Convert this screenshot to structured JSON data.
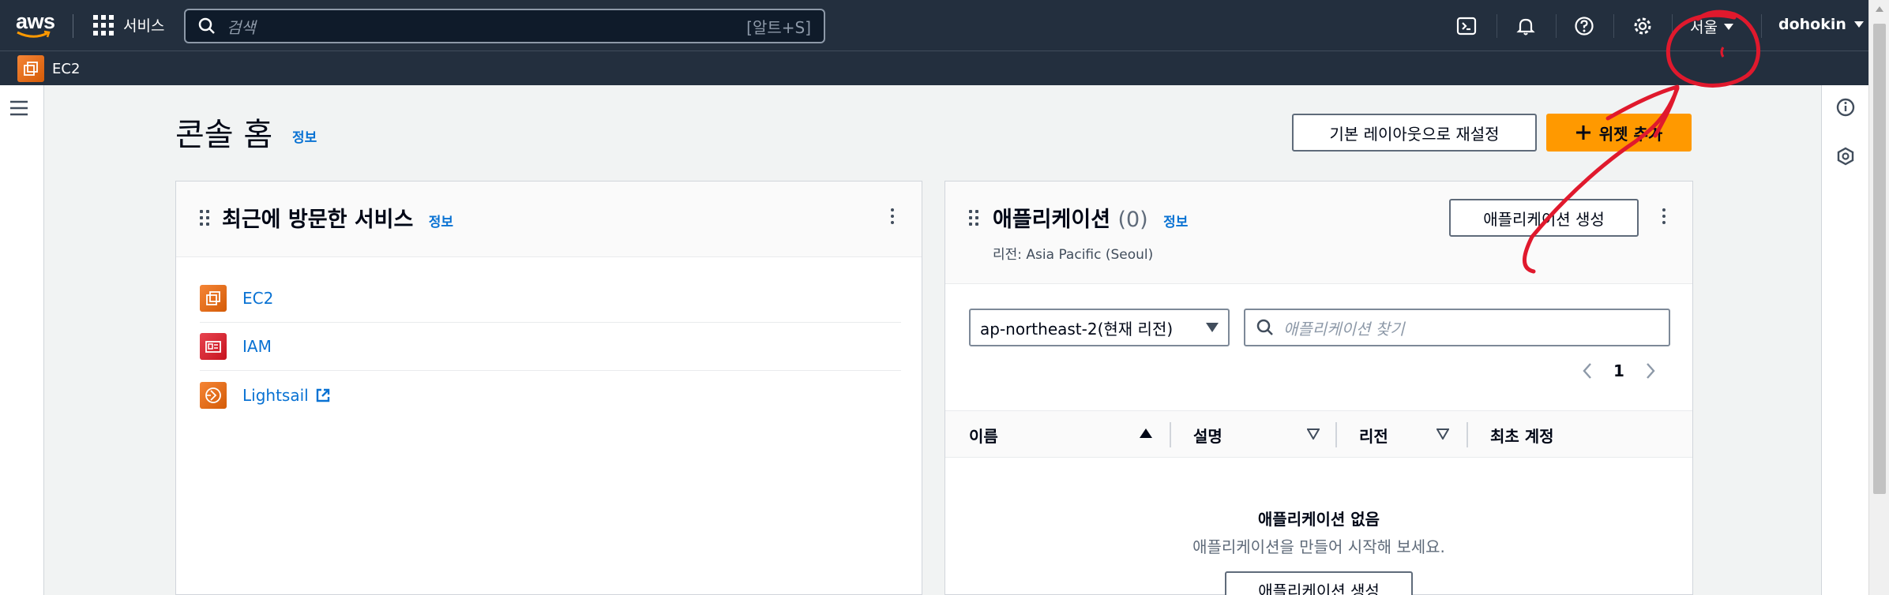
{
  "nav": {
    "logo": "aws",
    "services_label": "서비스",
    "search_placeholder": "검색",
    "search_shortcut": "[알트+S]",
    "region": "서울",
    "user": "dohokin",
    "icons": [
      "cloudshell-icon",
      "bell-icon",
      "help-icon",
      "settings-icon"
    ]
  },
  "favorites": {
    "ec2_label": "EC2"
  },
  "page": {
    "title": "콘솔 홈",
    "info": "정보",
    "reset_button": "기본 레이아웃으로 재설정",
    "add_widget_button": "위젯 추가"
  },
  "recent": {
    "title": "최근에 방문한 서비스",
    "info": "정보",
    "items": [
      {
        "label": "EC2",
        "icon": "ec2-icon",
        "color": "#e8731f"
      },
      {
        "label": "IAM",
        "icon": "iam-icon",
        "color": "#dd344c"
      },
      {
        "label": "Lightsail",
        "icon": "lightsail-icon",
        "color": "#e8731f",
        "external": true
      }
    ]
  },
  "apps": {
    "title": "애플리케이션",
    "count": "(0)",
    "info": "정보",
    "region_sub": "리전: Asia Pacific (Seoul)",
    "create_button": "애플리케이션 생성",
    "region_select": "ap-northeast-2(현재 리전)",
    "search_placeholder": "애플리케이션 찾기",
    "page_number": "1",
    "columns": [
      "이름",
      "설명",
      "리전",
      "최초 계정"
    ],
    "empty_title": "애플리케이션 없음",
    "empty_sub": "애플리케이션을 만들어 시작해 보세요.",
    "empty_button": "애플리케이션 생성"
  },
  "colors": {
    "nav_bg": "#232f3e",
    "accent_orange": "#ff9900",
    "link_blue": "#0972d3",
    "annotation_red": "#e0192d"
  }
}
